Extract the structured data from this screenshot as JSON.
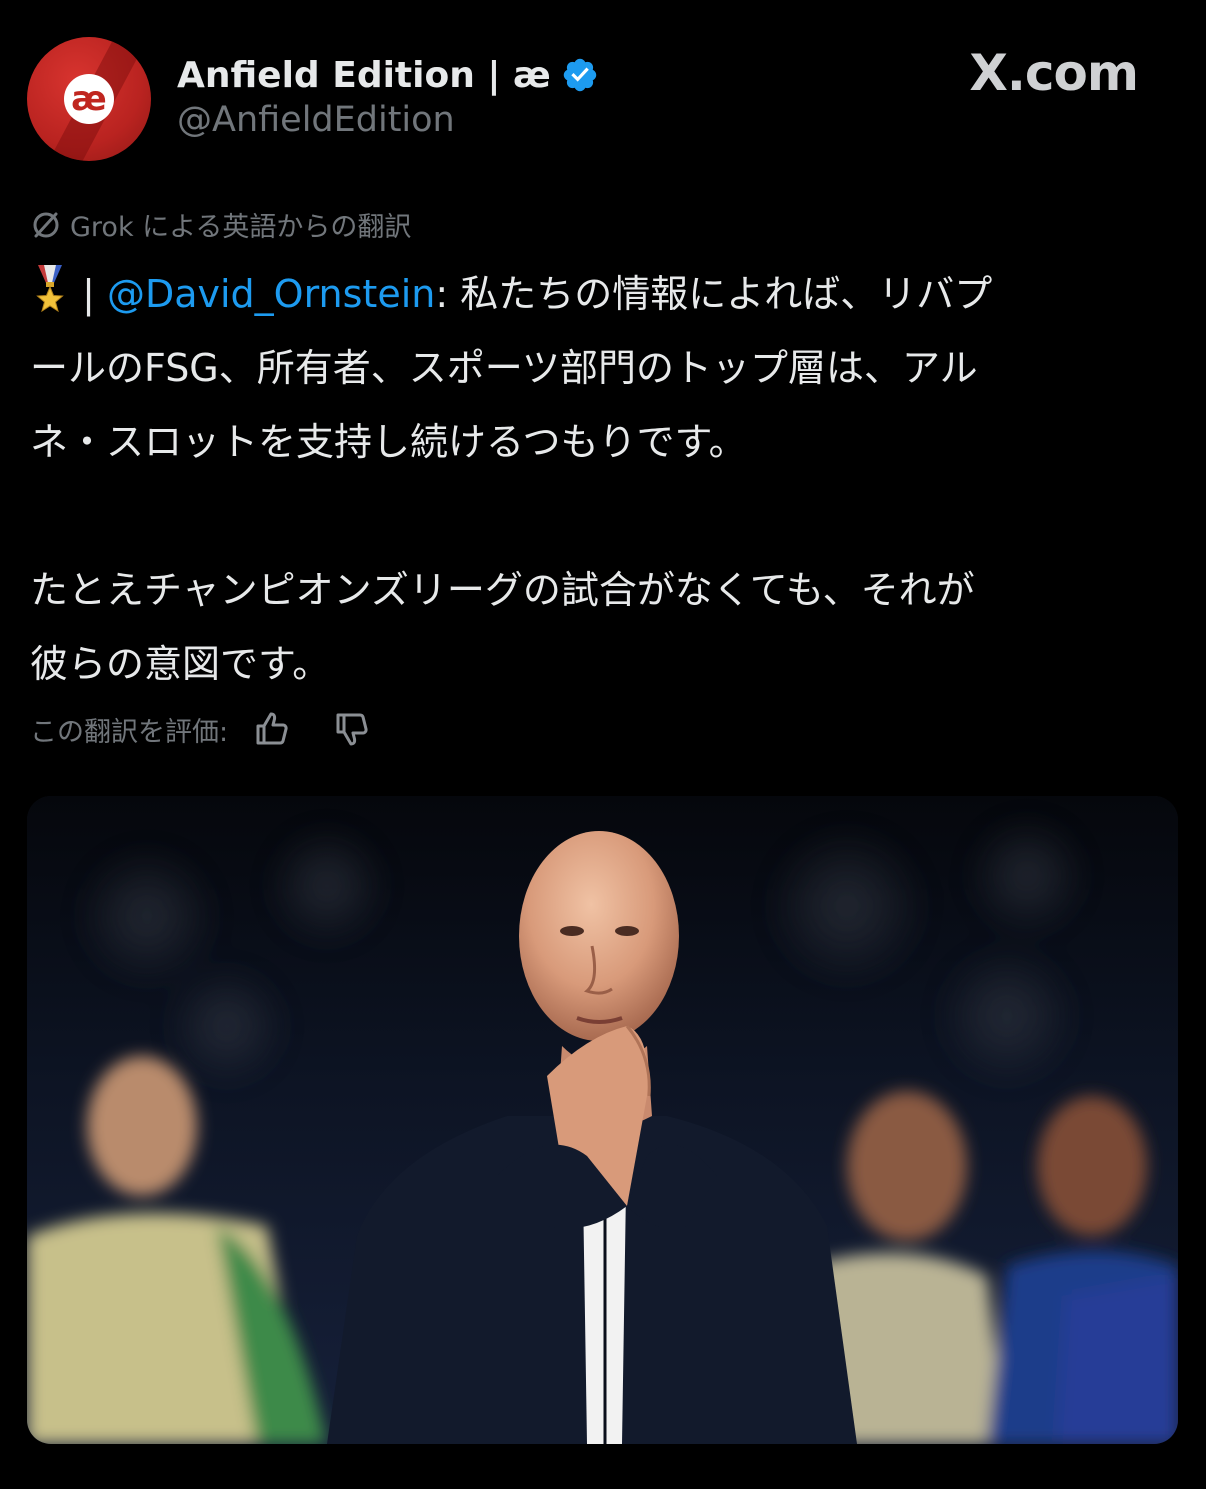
{
  "author": {
    "display_name": "Anfield Edition | æ",
    "handle": "@AnfieldEdition",
    "avatar_text": "æ",
    "verified": true
  },
  "source": {
    "label": "X.com"
  },
  "translation": {
    "note": "Grok による英語からの翻訳",
    "rate_label": "この翻訳を評価:"
  },
  "tweet": {
    "separator": " | ",
    "mention": "@David_Ornstein",
    "line1_rest": ": 私たちの情報によれば、リバプ",
    "line2": "ールのFSG、所有者、スポーツ部門のトップ層は、アル",
    "line3": "ネ・スロットを支持し続けるつもりです。",
    "line4": "たとえチャンピオンズリーグの試合がなくても、それが",
    "line5": "彼らの意図です。"
  },
  "icons": {
    "verified": "verified-badge-icon",
    "grok": "grok-icon",
    "medal": "medal-emoji-icon",
    "thumbs_up": "thumbs-up-icon",
    "thumbs_down": "thumbs-down-icon"
  },
  "colors": {
    "background": "#000000",
    "text": "#e7e9ea",
    "muted": "#71767b",
    "link": "#1d9bf0",
    "avatar": "#c0261f",
    "verified": "#1d9bf0"
  }
}
